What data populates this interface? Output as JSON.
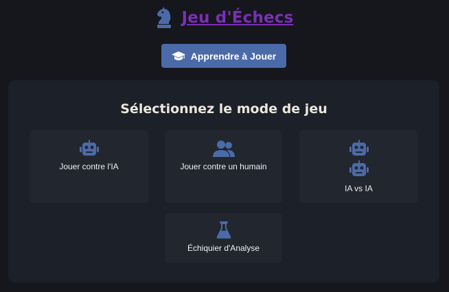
{
  "header": {
    "title": "Jeu d'Échecs",
    "logo_icon": "chess-knight-icon",
    "title_color": "#7a2fb4"
  },
  "learn_button": {
    "label": "Apprendre à Jouer",
    "icon": "graduation-cap-icon",
    "color": "#4b6aa8"
  },
  "mode_panel": {
    "title": "Sélectionnez le mode de jeu",
    "icon_color": "#4b6aa8",
    "modes": [
      {
        "label": "Jouer contre l'IA",
        "icon": "robot-icon"
      },
      {
        "label": "Jouer contre un humain",
        "icon": "users-icon"
      },
      {
        "label": "IA vs IA",
        "icon": "robot-icon"
      },
      {
        "label": "Échiquier d'Analyse",
        "icon": "flask-icon"
      }
    ]
  }
}
